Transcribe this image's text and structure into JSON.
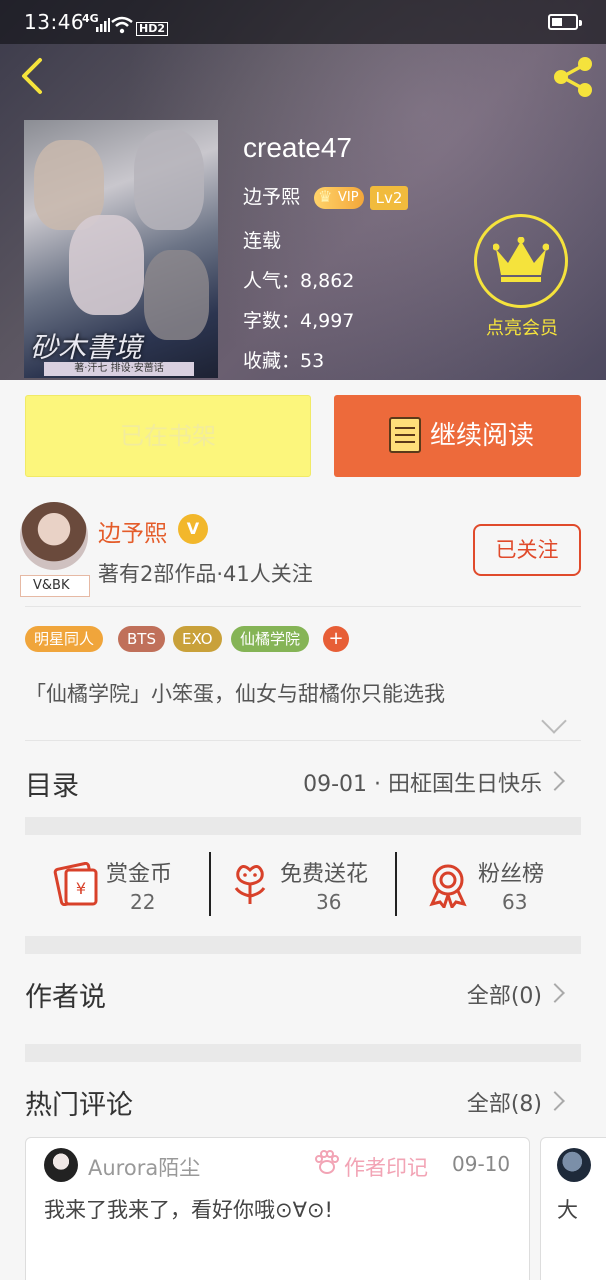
{
  "status_bar": {
    "time": "13:46",
    "network": "4G",
    "hd": "HD2"
  },
  "book": {
    "title": "create47",
    "author": "边予熙",
    "vip": "VIP",
    "level": "Lv2",
    "status": "连载",
    "popularity": "人气：8,862",
    "word_count": "字数：4,997",
    "favorites": "收藏：53",
    "cover_title": "砂木書境",
    "cover_band": "著·汗七 排设·安蔷话"
  },
  "member_label": "点亮会员",
  "actions": {
    "shelf": "已在书架",
    "read": "继续阅读"
  },
  "author": {
    "name": "边予熙",
    "badge": "V",
    "tag": "V&BK",
    "meta": "著有2部作品·41人关注",
    "follow": "已关注"
  },
  "tags": [
    {
      "label": "明星同人",
      "color": "#f0a53b"
    },
    {
      "label": "BTS",
      "color": "#c0705a"
    },
    {
      "label": "EXO",
      "color": "#c9a13a"
    },
    {
      "label": "仙橘学院",
      "color": "#85b456"
    }
  ],
  "tag_plus": "+",
  "blurb": "「仙橘学院」小笨蛋，仙女与甜橘你只能选我",
  "toc": {
    "label": "目录",
    "latest": "09-01 · 田柾国生日快乐"
  },
  "stats": [
    {
      "label": "赏金币",
      "value": "22",
      "icon": "red-envelope-icon"
    },
    {
      "label": "免费送花",
      "value": "36",
      "icon": "flower-icon"
    },
    {
      "label": "粉丝榜",
      "value": "63",
      "icon": "medal-icon"
    }
  ],
  "author_says": {
    "label": "作者说",
    "all": "全部(0)"
  },
  "hot_comments": {
    "label": "热门评论",
    "all": "全部(8)"
  },
  "comments": [
    {
      "user": "Aurora陌尘",
      "mark": "作者印记",
      "date": "09-10",
      "text": "我来了我来了，看好你哦⊙∀⊙!"
    },
    {
      "text": "大"
    }
  ],
  "colors": {
    "accent": "#ed6a3b",
    "member": "#f5e33c",
    "shelf": "#fcf67c"
  }
}
